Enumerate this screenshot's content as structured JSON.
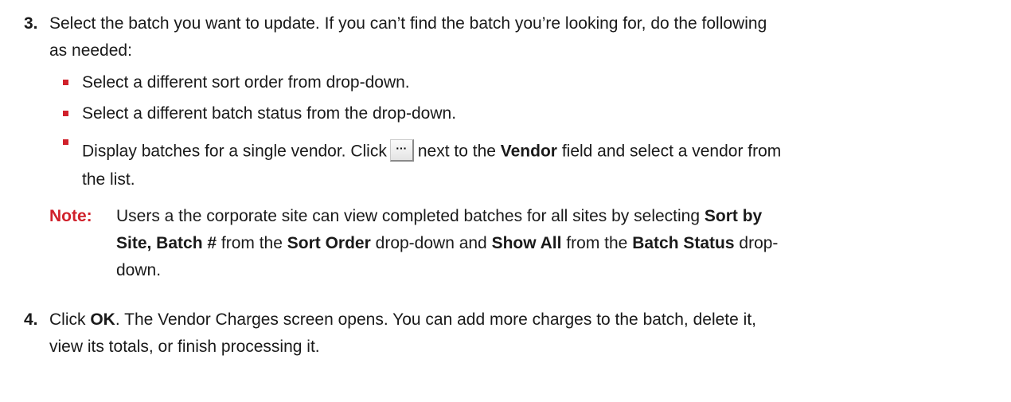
{
  "step3": {
    "number": "3.",
    "line1": "Select the batch you want to update. If you can’t find the batch you’re looking for, do the following",
    "line2": "as needed:",
    "bullets": {
      "b1": "Select a different sort order from drop-down.",
      "b2": "Select a different batch status from the drop-down.",
      "b3_pre": "Display batches for a single vendor. Click",
      "b3_btn": "···",
      "b3_mid": "next to the",
      "b3_vendor": "Vendor",
      "b3_post": "field and select a vendor from",
      "b3_line2": "the list."
    },
    "note": {
      "label": "Note:",
      "l1_pre": "Users a the corporate site can view completed batches for all sites by selecting",
      "l1_bold": "Sort by",
      "l2_bold1": "Site, Batch #",
      "l2_from": "from the",
      "l2_bold2": "Sort Order",
      "l2_drop": "drop-down and",
      "l2_bold3": "Show All",
      "l2_from2": "from the",
      "l2_bold4": "Batch Status",
      "l2_end": "drop-",
      "l3": "down."
    }
  },
  "step4": {
    "number": "4.",
    "pre": "Click",
    "ok": "OK",
    "post": ". The Vendor Charges screen opens. You can add more charges to the batch, delete it,",
    "line2": "view its totals, or finish processing it."
  },
  "colors": {
    "accent": "#d0212b",
    "text": "#1a1a1a"
  }
}
